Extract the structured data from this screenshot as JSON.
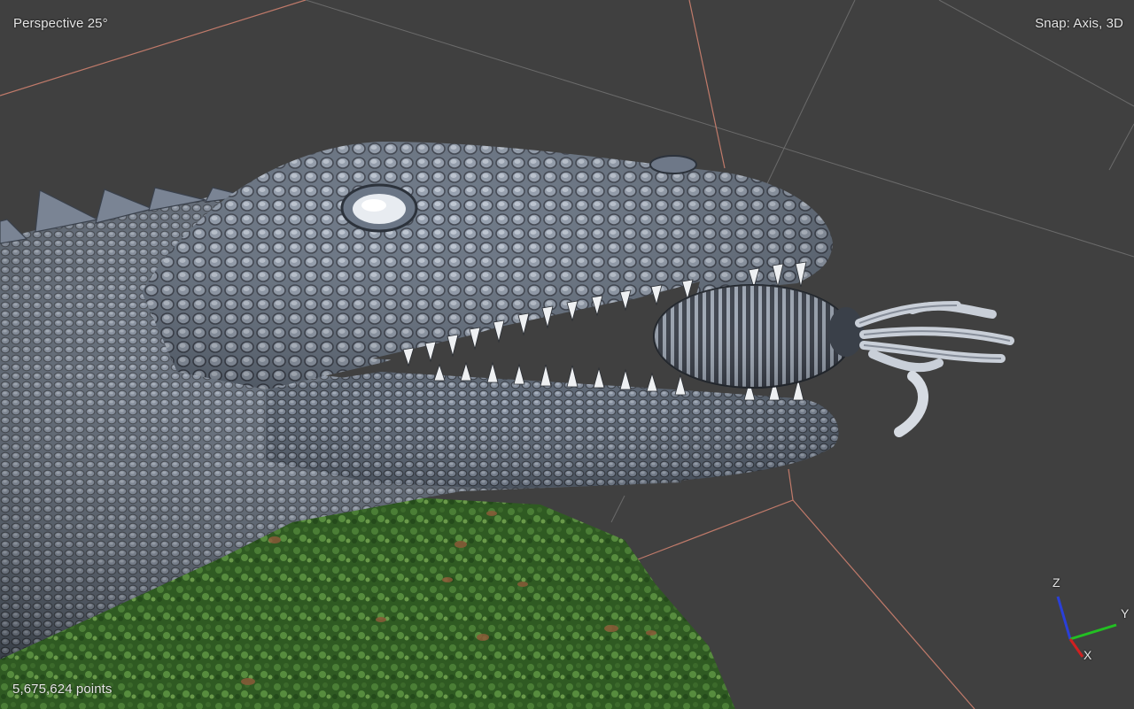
{
  "viewport": {
    "view_mode": "Perspective 25°",
    "snap_mode": "Snap: Axis, 3D",
    "point_count": "5,675,624 points",
    "background_color": "#404040",
    "grid_color": "#9a9a9a",
    "bounding_box_color": "#c07a6a",
    "model": "point-cloud-dinosaur-head",
    "axis_gizmo": {
      "z_label": "Z",
      "y_label": "Y",
      "x_label": "X",
      "z_color": "#2a3fd8",
      "y_color": "#22c022",
      "x_color": "#d02020"
    }
  }
}
